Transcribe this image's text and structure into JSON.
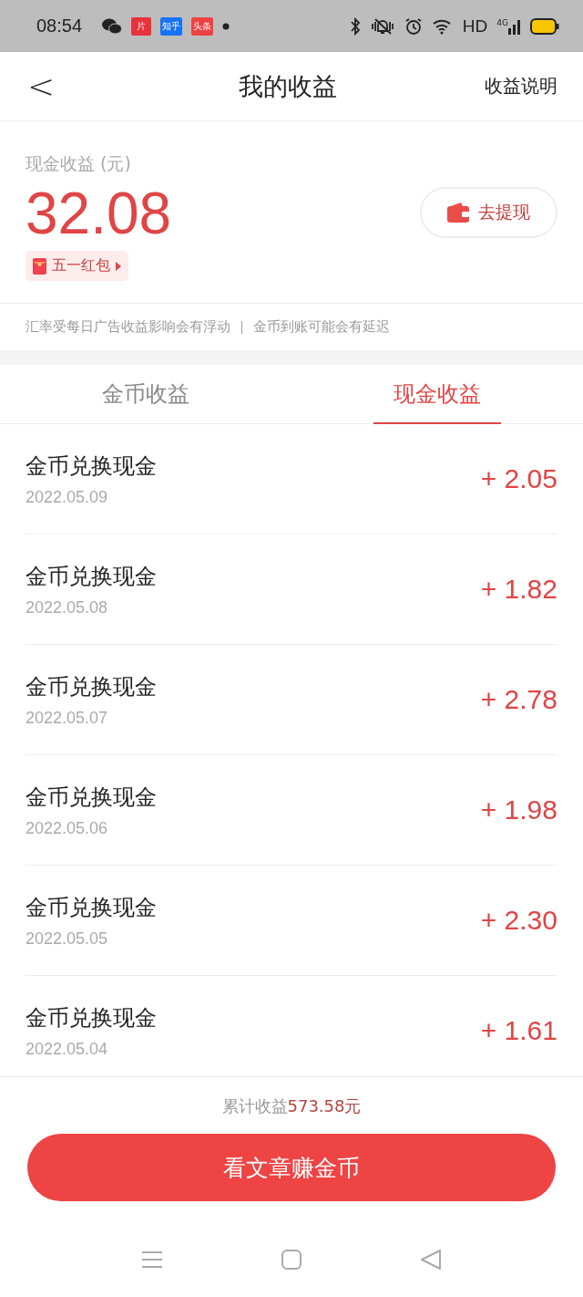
{
  "status_bar": {
    "time": "08:54",
    "app_badges": [
      {
        "label": "片",
        "color": "#e8323c"
      },
      {
        "label": "知乎",
        "color": "#1772f6"
      },
      {
        "label": "头条",
        "color": "#f04142"
      }
    ],
    "network": "HD",
    "signal_label": "4G"
  },
  "header": {
    "title": "我的收益",
    "back": "<",
    "action": "收益说明"
  },
  "summary": {
    "label": "现金收益 (元)",
    "amount": "32.08",
    "promo": "五一红包",
    "withdraw": "去提现"
  },
  "notice": [
    "汇率受每日广告收益影响会有浮动",
    "金币到账可能会有延迟"
  ],
  "tabs": [
    {
      "label": "金币收益",
      "selected": false
    },
    {
      "label": "现金收益",
      "selected": true
    }
  ],
  "records": [
    {
      "title": "金币兑换现金",
      "date": "2022.05.09",
      "amount": "+ 2.05"
    },
    {
      "title": "金币兑换现金",
      "date": "2022.05.08",
      "amount": "+ 1.82"
    },
    {
      "title": "金币兑换现金",
      "date": "2022.05.07",
      "amount": "+ 2.78"
    },
    {
      "title": "金币兑换现金",
      "date": "2022.05.06",
      "amount": "+ 1.98"
    },
    {
      "title": "金币兑换现金",
      "date": "2022.05.05",
      "amount": "+ 2.30"
    },
    {
      "title": "金币兑换现金",
      "date": "2022.05.04",
      "amount": "+ 1.61"
    }
  ],
  "total": {
    "label": "累计收益",
    "amount": "573.58元"
  },
  "cta": "看文章赚金币"
}
